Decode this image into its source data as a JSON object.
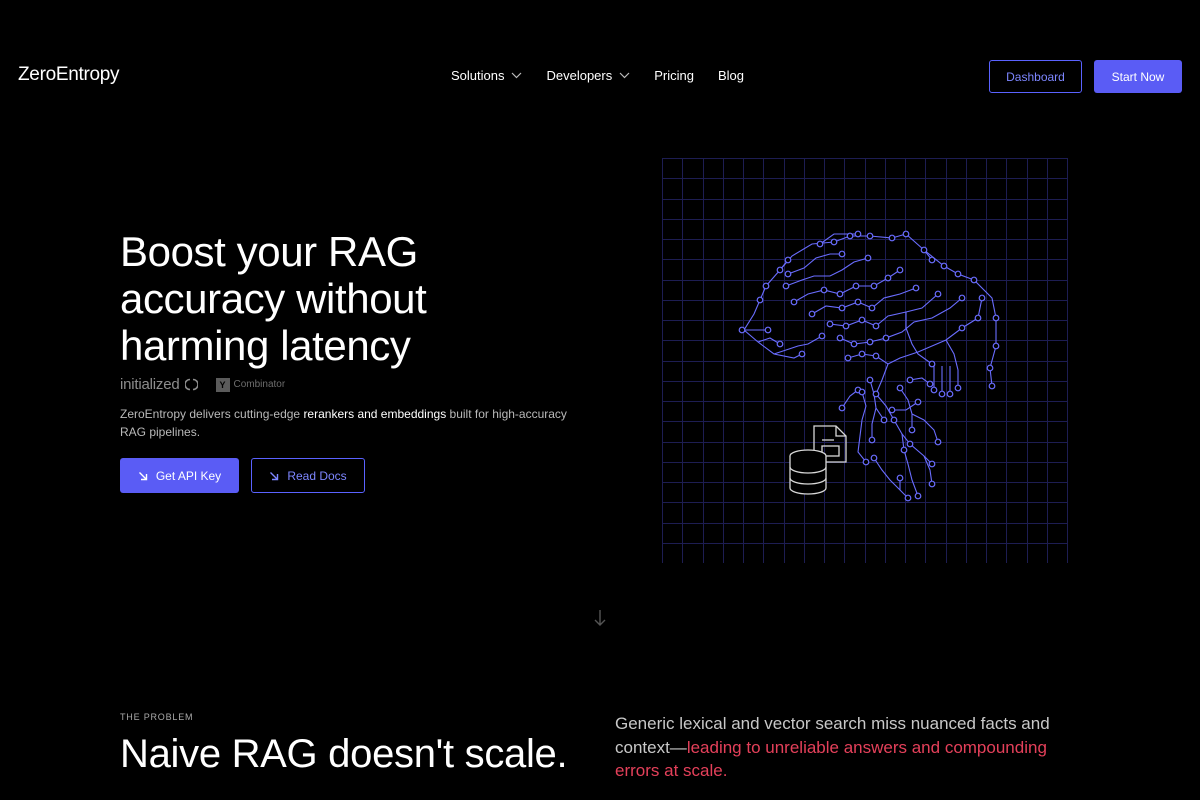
{
  "nav": {
    "logo": "ZeroEntropy",
    "links": [
      {
        "label": "Solutions",
        "has_dropdown": true
      },
      {
        "label": "Developers",
        "has_dropdown": true
      },
      {
        "label": "Pricing",
        "has_dropdown": false
      },
      {
        "label": "Blog",
        "has_dropdown": false
      }
    ],
    "dashboard_label": "Dashboard",
    "start_label": "Start Now"
  },
  "hero": {
    "title": "Boost your RAG accuracy without harming latency",
    "backers": {
      "initialized": "initialized",
      "yc_mark": "Y",
      "yc_text": "Combinator"
    },
    "description_pre": "ZeroEntropy delivers cutting-edge ",
    "description_highlight": "rerankers and embeddings",
    "description_post": " built for high-accuracy RAG pipelines.",
    "api_button": "Get API Key",
    "docs_button": "Read Docs"
  },
  "problem": {
    "eyebrow": "THE PROBLEM",
    "title": "Naive RAG doesn't scale.",
    "text_pre": "Generic lexical and vector search miss nuanced facts and context—",
    "text_highlight": "leading to unreliable answers and compounding errors at scale."
  },
  "colors": {
    "accent": "#5a5cf5",
    "accent_outline": "#5a62ff",
    "highlight_red": "#e4405a",
    "circuit": "#6a6dff",
    "grid": "#1d1d52"
  },
  "icons": {
    "dropdown": "chevron-down-icon",
    "cta_arrow": "arrow-down-right-icon",
    "scroll": "arrow-down-icon",
    "illustration": "brain-circuit-illustration"
  }
}
